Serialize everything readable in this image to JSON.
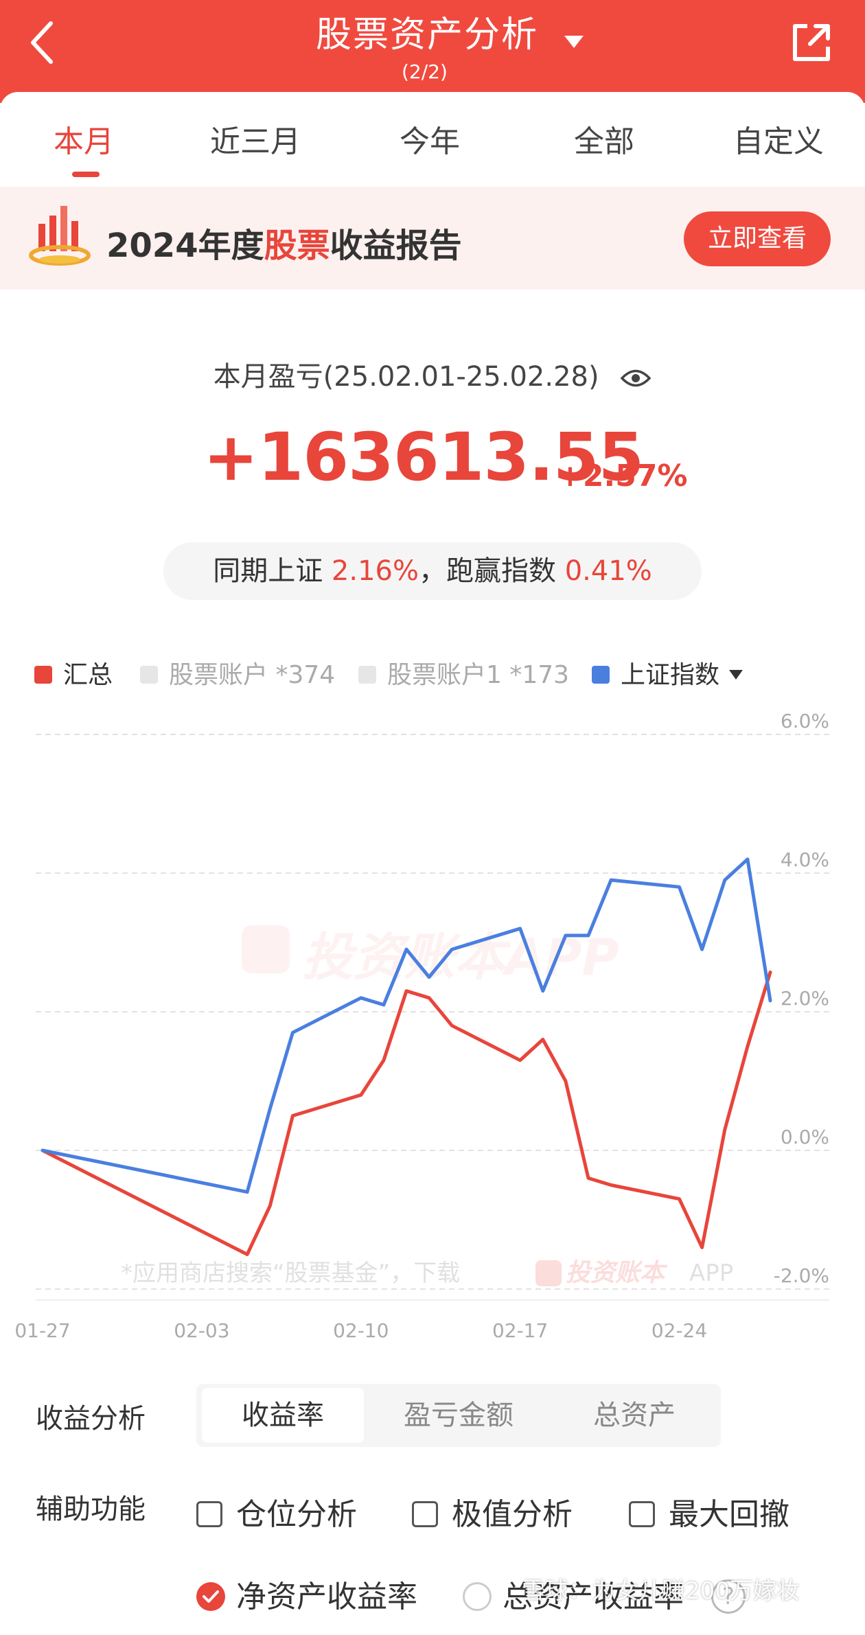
{
  "header": {
    "title": "股票资产分析",
    "subtitle": "(2/2)"
  },
  "tabs": [
    {
      "label": "本月",
      "active": true
    },
    {
      "label": "近三月",
      "active": false
    },
    {
      "label": "今年",
      "active": false
    },
    {
      "label": "全部",
      "active": false
    },
    {
      "label": "自定义",
      "active": false
    }
  ],
  "banner": {
    "prefix": "2024年度",
    "highlight": "股票",
    "suffix": "收益报告",
    "button": "立即查看"
  },
  "pl": {
    "label": "本月盈亏(25.02.01-25.02.28)",
    "value": "+163613.55",
    "pct": "+2.57%"
  },
  "compare": {
    "prefix": "同期上证",
    "index_pct": "2.16%",
    "middle": "，跑赢指数",
    "beat_pct": "0.41%"
  },
  "legend": [
    {
      "label": "汇总",
      "color": "#e8453b",
      "active": true
    },
    {
      "label": "股票账户 *374",
      "color": "#e6e6e6",
      "active": false
    },
    {
      "label": "股票账户1 *173",
      "color": "#e6e6e6",
      "active": false
    },
    {
      "label": "上证指数",
      "color": "#4a7fe0",
      "active": true
    }
  ],
  "chart_data": {
    "type": "line",
    "x_ticks": [
      "01-27",
      "02-03",
      "02-10",
      "02-17",
      "02-24"
    ],
    "y_ticks": [
      "6.0%",
      "4.0%",
      "2.0%",
      "0.0%",
      "-2.0%"
    ],
    "ylim": [
      -2.0,
      6.0
    ],
    "watermark": "投资账本APP",
    "footnote": "*应用商店搜索“股票基金”，下载",
    "footnote_brand": "投资账本",
    "footnote_app": "APP",
    "series": [
      {
        "name": "汇总",
        "color": "#e8453b",
        "x": [
          "01-27",
          "02-05",
          "02-06",
          "02-07",
          "02-10",
          "02-11",
          "02-12",
          "02-13",
          "02-14",
          "02-17",
          "02-18",
          "02-19",
          "02-20",
          "02-21",
          "02-24",
          "02-25",
          "02-26",
          "02-27",
          "02-28"
        ],
        "y": [
          0.0,
          -1.5,
          -0.8,
          0.5,
          0.8,
          1.3,
          2.3,
          2.2,
          1.8,
          1.3,
          1.6,
          1.0,
          -0.4,
          -0.5,
          -0.7,
          -1.4,
          0.3,
          1.5,
          2.57
        ]
      },
      {
        "name": "上证指数",
        "color": "#4a7fe0",
        "x": [
          "01-27",
          "02-05",
          "02-06",
          "02-07",
          "02-10",
          "02-11",
          "02-12",
          "02-13",
          "02-14",
          "02-17",
          "02-18",
          "02-19",
          "02-20",
          "02-21",
          "02-24",
          "02-25",
          "02-26",
          "02-27",
          "02-28"
        ],
        "y": [
          0.0,
          -0.6,
          0.6,
          1.7,
          2.2,
          2.1,
          2.9,
          2.5,
          2.9,
          3.2,
          2.3,
          3.1,
          3.1,
          3.9,
          3.8,
          2.9,
          3.9,
          4.2,
          2.16
        ]
      }
    ]
  },
  "analysis": {
    "label": "收益分析",
    "options": [
      {
        "label": "收益率",
        "active": true
      },
      {
        "label": "盈亏金额",
        "active": false
      },
      {
        "label": "总资产",
        "active": false
      }
    ]
  },
  "aux": {
    "label": "辅助功能",
    "checkboxes": [
      "仓位分析",
      "极值分析",
      "最大回撤"
    ]
  },
  "rates": {
    "net": "净资产收益率",
    "total": "总资产收益率",
    "help": "?"
  },
  "watermark": "雪球：为女儿赚200万嫁妆"
}
